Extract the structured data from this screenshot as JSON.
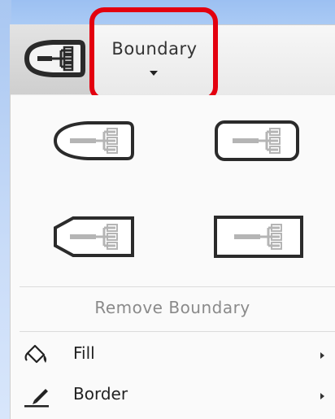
{
  "toolbar": {
    "tool_icon": "boundary-shape-icon",
    "dropdown_label": "Boundary",
    "dropdown_icon": "caret-down-icon"
  },
  "menu": {
    "shapes": [
      {
        "name": "rounded-boundary-shape",
        "icon": "rounded-boundary-icon"
      },
      {
        "name": "rounded-rectangle-boundary-shape",
        "icon": "rounded-rectangle-boundary-icon"
      },
      {
        "name": "trapezoid-boundary-shape",
        "icon": "trapezoid-boundary-icon"
      },
      {
        "name": "rectangle-boundary-shape",
        "icon": "rectangle-boundary-icon"
      }
    ],
    "remove_label": "Remove Boundary",
    "items": [
      {
        "label": "Fill",
        "icon": "paint-bucket-icon",
        "has_submenu": true
      },
      {
        "label": "Border",
        "icon": "pen-icon",
        "has_submenu": true
      }
    ]
  },
  "colors": {
    "highlight": "#e3000f",
    "background": "#a9c7f1",
    "menu_background": "#fafafa",
    "disabled_text": "#8a8a8a"
  }
}
